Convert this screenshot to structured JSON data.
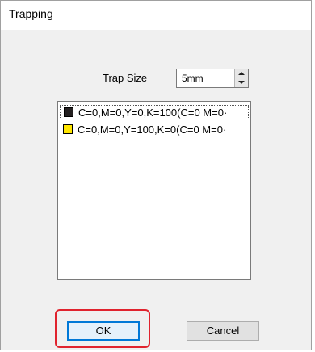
{
  "window": {
    "title": "Trapping"
  },
  "trap_size": {
    "label": "Trap Size",
    "value": "5mm",
    "up_icon": "spin-up-arrow",
    "down_icon": "spin-down-arrow"
  },
  "colors_list": {
    "items": [
      {
        "swatch_color": "#231f20",
        "label": "C=0,M=0,Y=0,K=100(C=0 M=0·"
      },
      {
        "swatch_color": "#ffe600",
        "label": "C=0,M=0,Y=100,K=0(C=0 M=0·"
      }
    ]
  },
  "buttons": {
    "ok_label": "OK",
    "cancel_label": "Cancel"
  },
  "annotation": {
    "highlight_color": "#e0232e",
    "highlight_target": "ok-button"
  }
}
